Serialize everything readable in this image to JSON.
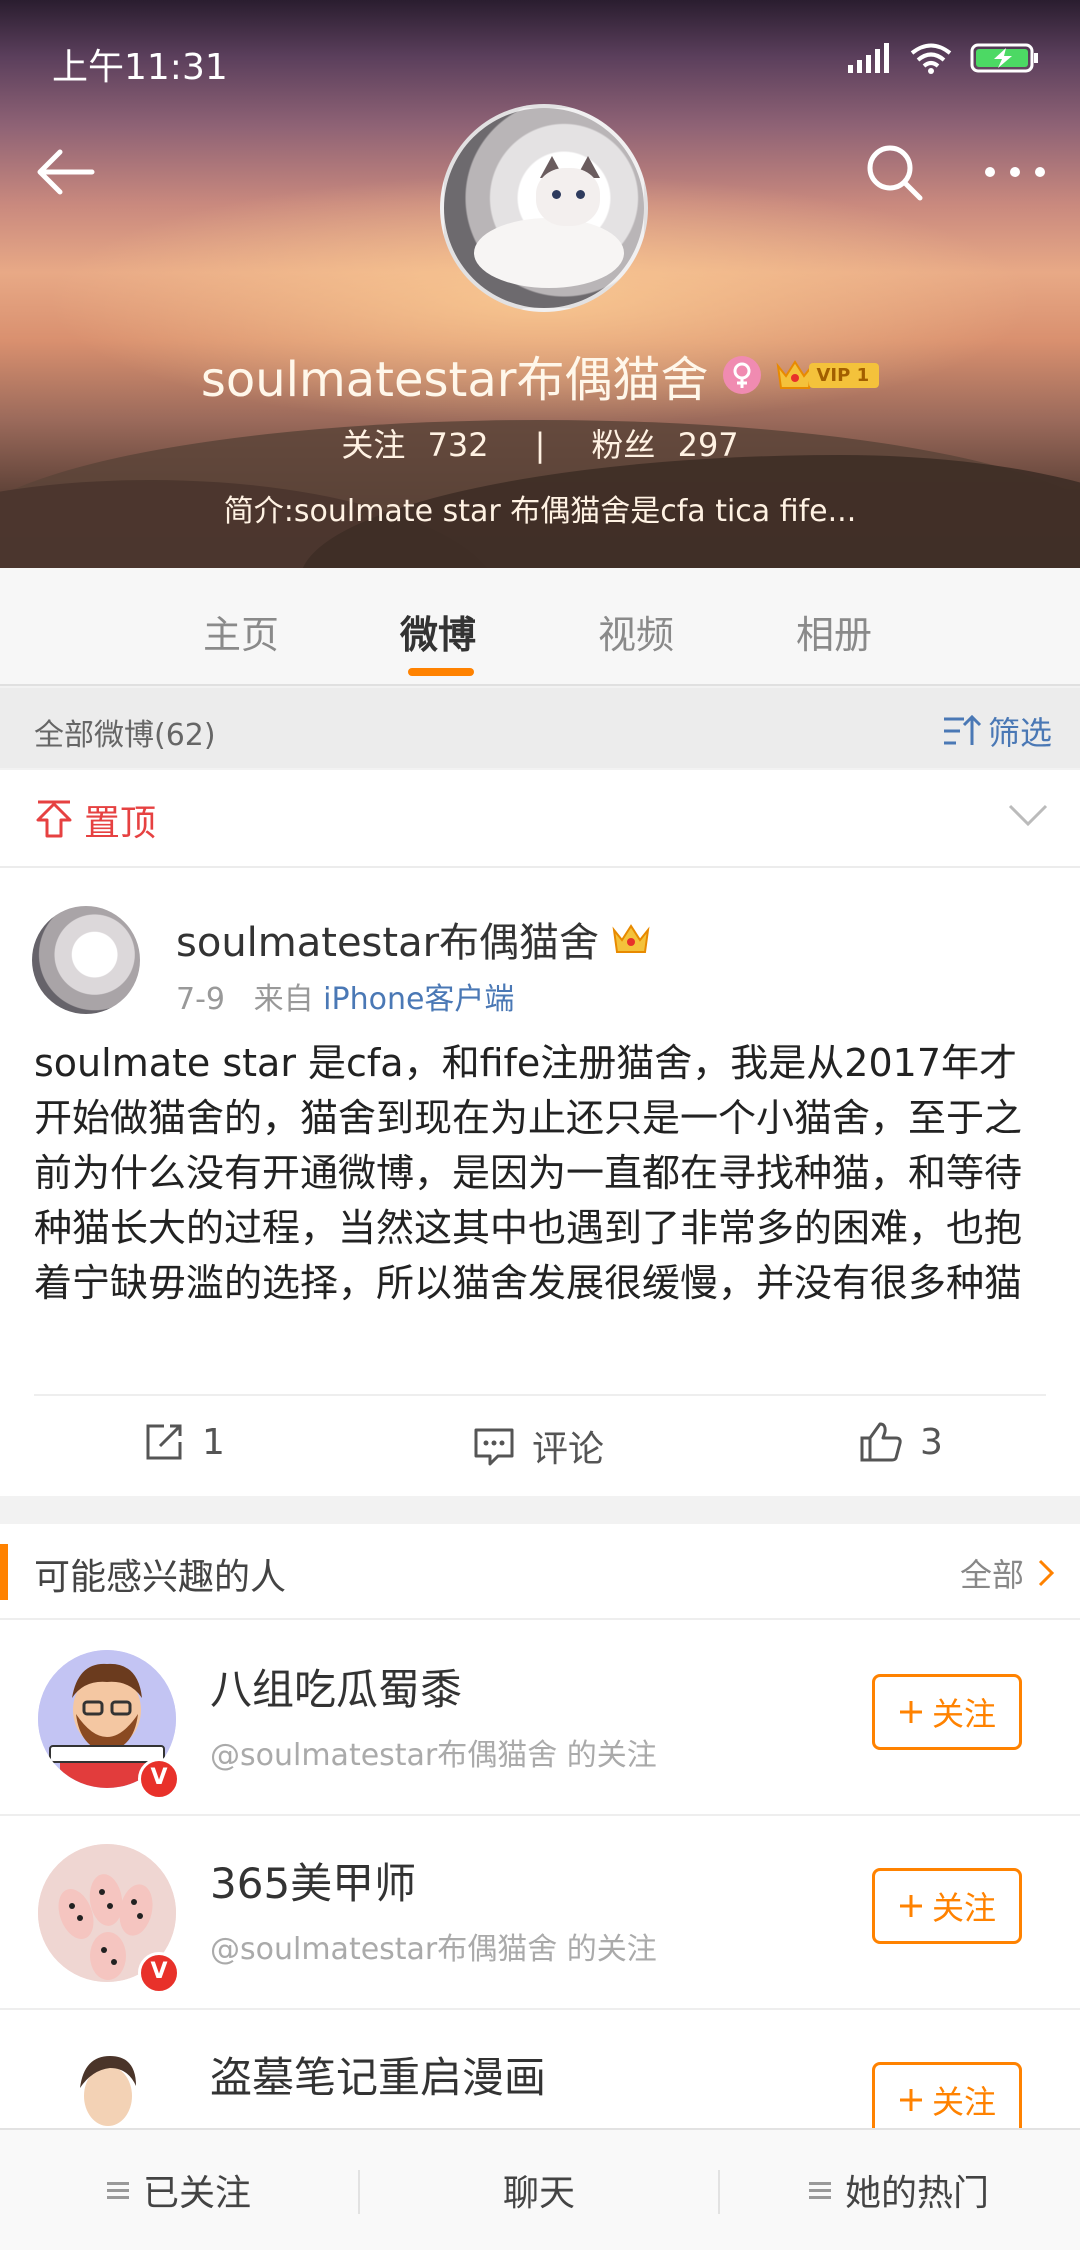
{
  "status_bar": {
    "time": "上午11:31"
  },
  "profile": {
    "name": "soulmatestar布偶猫舍",
    "vip_label": "VIP 1",
    "following_label": "关注",
    "following_count": "732",
    "separator": "|",
    "followers_label": "粉丝",
    "followers_count": "297",
    "bio": "简介:soulmate star 布偶猫舍是cfa tica fife..."
  },
  "tabs": [
    {
      "label": "主页",
      "active": false
    },
    {
      "label": "微博",
      "active": true
    },
    {
      "label": "视频",
      "active": false
    },
    {
      "label": "相册",
      "active": false
    }
  ],
  "filter": {
    "count_label": "全部微博(62)",
    "filter_label": "筛选"
  },
  "pinned": {
    "label": "置顶"
  },
  "post": {
    "author": "soulmatestar布偶猫舍",
    "date": "7-9",
    "source_prefix": "来自",
    "source": "iPhone客户端",
    "text": "soulmate star 是cfa，和fife注册猫舍，我是从2017年才开始做猫舍的，猫舍到现在为止还只是一个小猫舍，至于之前为什么没有开通微博，是因为一直都在寻找种猫，和等待种猫长大的过程，当然这其中也遇到了非常多的困难，也抱着宁缺毋滥的选择，所以猫舍发展很缓慢，并没有很多种猫",
    "repost_count": "1",
    "comment_label": "评论",
    "like_count": "3"
  },
  "recommend": {
    "title": "可能感兴趣的人",
    "all_label": "全部",
    "follow_label": "关注",
    "items": [
      {
        "name": "八组吃瓜蜀黍",
        "sub": "@soulmatestar布偶猫舍 的关注",
        "verified": true
      },
      {
        "name": "365美甲师",
        "sub": "@soulmatestar布偶猫舍 的关注",
        "verified": true
      },
      {
        "name": "盗墓笔记重启漫画",
        "sub": "",
        "verified": false
      }
    ]
  },
  "bottom_bar": {
    "followed": "已关注",
    "chat": "聊天",
    "hot": "她的热门"
  },
  "colors": {
    "accent": "#ff8200",
    "link": "#4a78b5",
    "pin": "#e64141",
    "verified": "#e8312a"
  }
}
